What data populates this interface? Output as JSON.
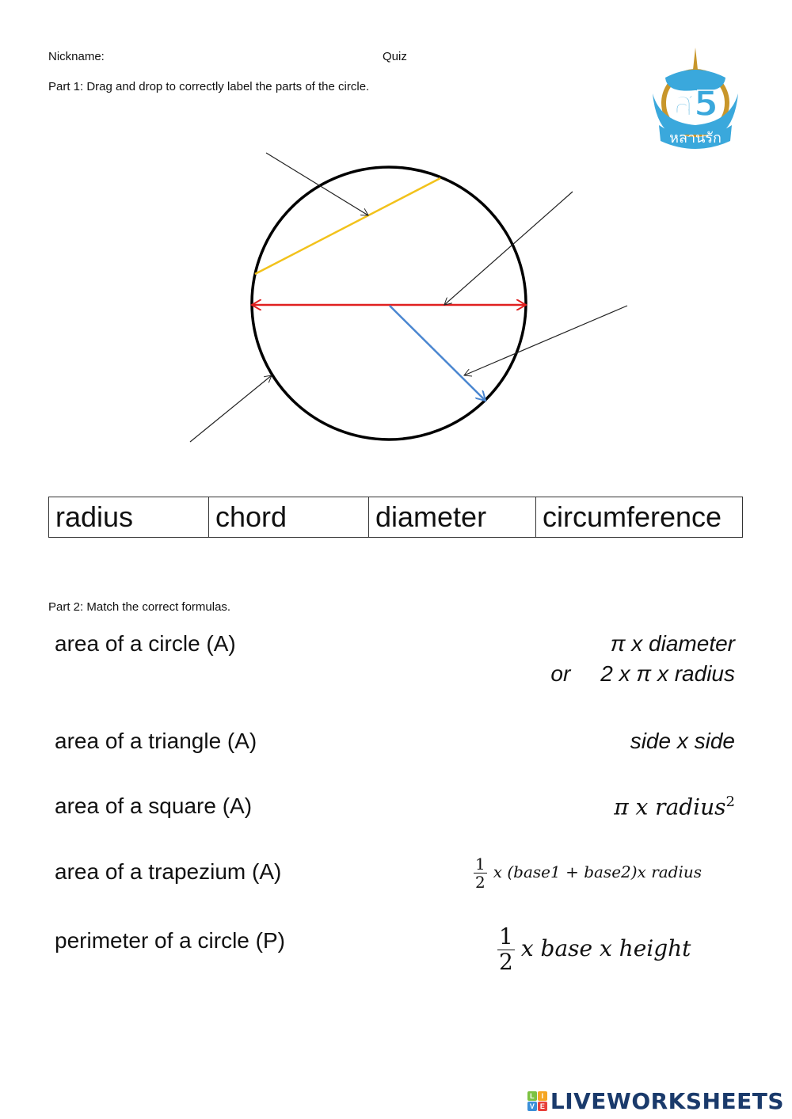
{
  "header": {
    "nickname_label": "Nickname:",
    "quiz_label": "Quiz",
    "part1_instruction": "Part 1: Drag and drop to correctly label the parts of the circle."
  },
  "logo": {
    "text_top": "ส5",
    "text_ribbon": "หลานรัก",
    "colors": {
      "blue": "#3aa8dc",
      "gold": "#c8962a"
    }
  },
  "diagram": {
    "colors": {
      "circle": "#000000",
      "chord": "#f2c21b",
      "diameter": "#e02020",
      "radius": "#4a86d0",
      "pointer": "#222222"
    }
  },
  "word_bank": [
    "radius",
    "chord",
    "diameter",
    "circumference"
  ],
  "part2": {
    "instruction": "Part 2: Match the correct formulas.",
    "labels": [
      "area of a circle (A)",
      "area of a triangle (A)",
      "area of a square (A)",
      "area of a trapezium (A)",
      "perimeter of a circle (P)"
    ],
    "formulas": {
      "f1_line1": "π x diameter",
      "f1_or": "or",
      "f1_line2": "2 x π x radius",
      "f2": "side x side",
      "f3_main": "π x radius",
      "f3_exp": "2",
      "f4_num": "1",
      "f4_den": "2",
      "f4_rest": "x (base1 + base2)x radius",
      "f5_num": "1",
      "f5_den": "2",
      "f5_rest": "x base x height"
    }
  },
  "footer": {
    "badge_letters": [
      "L",
      "I",
      "V",
      "E"
    ],
    "badge_colors": [
      "#7cc242",
      "#f5a623",
      "#3a8fd8",
      "#e8403a"
    ],
    "brand": "LIVEWORKSHEETS"
  }
}
